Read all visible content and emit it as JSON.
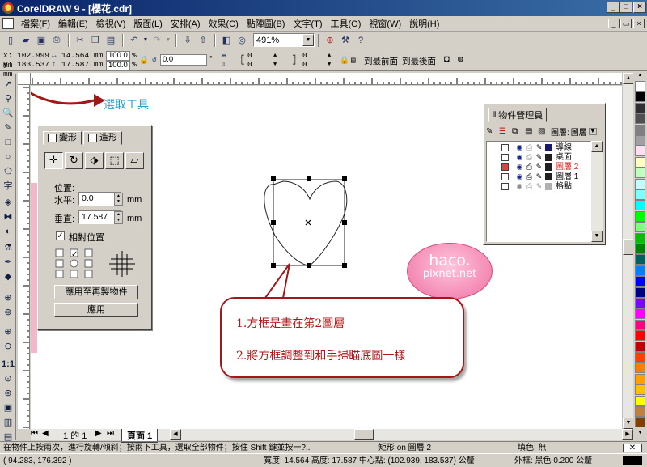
{
  "window": {
    "title": "CorelDRAW 9 - [櫻花.cdr]"
  },
  "menu": [
    "檔案(F)",
    "編輯(E)",
    "檢視(V)",
    "版面(L)",
    "安排(A)",
    "效果(C)",
    "點陣圖(B)",
    "文字(T)",
    "工具(O)",
    "視窗(W)",
    "說明(H)"
  ],
  "toolbar": {
    "zoom": "491%"
  },
  "propbar": {
    "x": "x: 102.999 mm",
    "y": "y: 183.537 mm",
    "w": "14.564 mm",
    "h": "17.587 mm",
    "scale_x": "100.0",
    "scale_y": "100.0",
    "pct": "%",
    "rotation": "0.0",
    "deg": "°",
    "c1": "0",
    "c2": "0",
    "c3": "0",
    "c4": "0",
    "to_front": "到最前面",
    "to_back": "到最後面"
  },
  "caption": {
    "select_tool": "選取工具"
  },
  "transform_docker": {
    "tab_transform": "變形",
    "tab_shape": "造形",
    "position_label": "位置:",
    "h_label": "水平:",
    "h_value": "0.0",
    "v_label": "垂直:",
    "v_value": "17.587",
    "unit": "mm",
    "relative": "相對位置",
    "apply_dup": "應用至再製物件",
    "apply": "應用"
  },
  "object_manager": {
    "title": "物件管理員",
    "layer_label": "圖層:",
    "layer_value": "圖層",
    "layers": [
      {
        "name": "導線",
        "color": "#1a1a6a"
      },
      {
        "name": "桌面",
        "color": "#202020"
      },
      {
        "name": "圖層 2",
        "color": "#202020",
        "active": true
      },
      {
        "name": "圖層 1",
        "color": "#202020"
      },
      {
        "name": "格點",
        "color": "#b0b0b0"
      }
    ]
  },
  "callout": {
    "line1": "1.方框是畫在第2圖層",
    "line2": "2.將方框調整到和手掃瞄底圖一樣"
  },
  "watermark": {
    "line1": "haco.",
    "line2": "pixnet.net"
  },
  "page_tabs": {
    "page_count": "1 的 1",
    "page_name": "頁面 1"
  },
  "status": {
    "hint": "在物件上按兩次，進行旋轉/傾斜；按兩下工具，選取全部物件；按住 Shift 鍵並按一?..",
    "object": "矩形 on 圖層 2",
    "fill": "填色: 無",
    "cursor": "( 94.283, 176.392 )",
    "dims": "寬度: 14.564 高度: 17.587 中心點: (102.939, 183.537) 公釐",
    "outline": "外框: 黑色 0.200 公釐"
  },
  "palette": [
    "#ffffff",
    "#000000",
    "#303030",
    "#505050",
    "#808080",
    "#a0a0a0",
    "#ffe0f0",
    "#ffffc0",
    "#c0ffc0",
    "#c0ffff",
    "#80ffff",
    "#00ffff",
    "#00ff00",
    "#80ff80",
    "#00c000",
    "#008000",
    "#006060",
    "#0080ff",
    "#0000ff",
    "#000080",
    "#8000ff",
    "#ff00ff",
    "#ff0080",
    "#ff0000",
    "#c00000",
    "#ff4000",
    "#ff8000",
    "#ffa000",
    "#ffc000",
    "#ffff00",
    "#c08040",
    "#804000"
  ]
}
